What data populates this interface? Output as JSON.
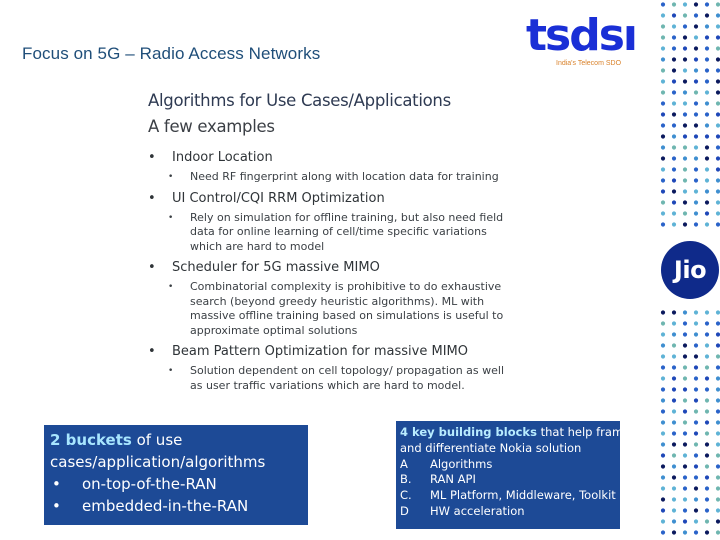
{
  "slide": {
    "title": "Focus on 5G – Radio Access Networks"
  },
  "logos": {
    "tsdsi": {
      "word": "tsdsı",
      "tagline": "India's Telecom SDO",
      "color": "#1a2fd6",
      "tagline_color": "#d9822b"
    },
    "jio": {
      "word": "Jio",
      "color": "#0f2a8a"
    }
  },
  "decor": {
    "dot_colors": [
      "#5fb3d6",
      "#0b1a5e",
      "#2a63c9",
      "#6fb6b0",
      "#3f8fd0",
      "#1f48b8"
    ]
  },
  "content": {
    "title": "Algorithms for Use Cases/Applications",
    "subtitle": "A few examples",
    "items": [
      {
        "label": "Indoor Location",
        "details": [
          "Need RF fingerprint along with location data for training"
        ]
      },
      {
        "label": "UI Control/CQI RRM Optimization",
        "details": [
          "Rely on simulation for offline training, but also need field data for online learning of cell/time specific variations which are hard to model"
        ]
      },
      {
        "label": "Scheduler for 5G massive MIMO",
        "details": [
          "Combinatorial complexity is prohibitive to do exhaustive search (beyond greedy heuristic algorithms). ML with massive offline training based on simulations is useful to approximate optimal solutions"
        ]
      },
      {
        "label": "Beam Pattern Optimization for massive MIMO",
        "details": [
          "Solution dependent on cell topology/ propagation as well as user traffic variations which are hard to model."
        ]
      }
    ]
  },
  "buckets_box": {
    "highlight": "2 buckets",
    "text": " of use cases/application/algorithms",
    "bullets": [
      "on-top-of-the-RAN",
      "embedded-in-the-RAN"
    ]
  },
  "building_blocks_box": {
    "highlight": "4 key building blocks",
    "text": " that help frame",
    "line2": "and differentiate Nokia solution",
    "items": [
      {
        "letter": "A",
        "label": "Algorithms"
      },
      {
        "letter": "B.",
        "label": "RAN API"
      },
      {
        "letter": "C.",
        "label": "ML Platform, Middleware, Toolkit"
      },
      {
        "letter": "D",
        "label": "HW acceleration"
      }
    ]
  }
}
